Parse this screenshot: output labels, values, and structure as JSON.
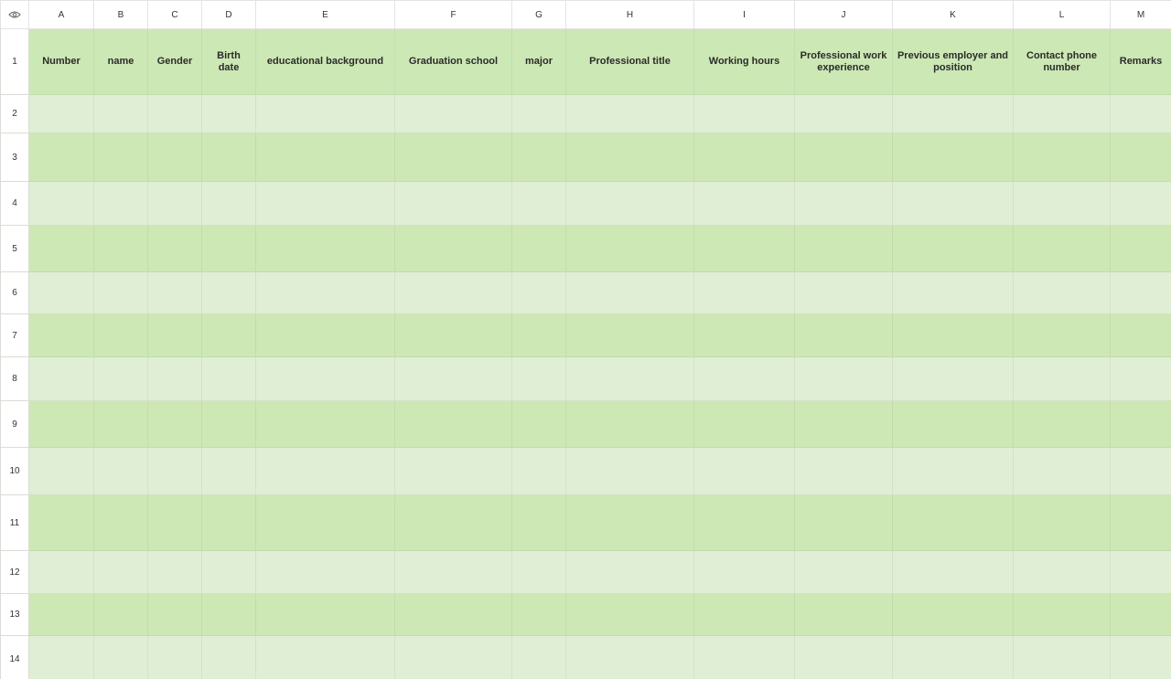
{
  "columns": [
    "A",
    "B",
    "C",
    "D",
    "E",
    "F",
    "G",
    "H",
    "I",
    "J",
    "K",
    "L",
    "M"
  ],
  "rows": [
    "1",
    "2",
    "3",
    "4",
    "5",
    "6",
    "7",
    "8",
    "9",
    "10",
    "11",
    "12",
    "13",
    "14"
  ],
  "header_cells": [
    "Number",
    "name",
    "Gender",
    "Birth date",
    "educational background",
    "Graduation school",
    "major",
    "Professional title",
    "Working hours",
    "Professional work experience",
    "Previous employer and position",
    "Contact phone number",
    "Remarks"
  ],
  "colors": {
    "header_fill": "#cce8b5",
    "light_row_fill": "#e0eed5",
    "dark_row_fill": "#cde8b5"
  },
  "icons": {
    "corner": "eye-icon"
  }
}
